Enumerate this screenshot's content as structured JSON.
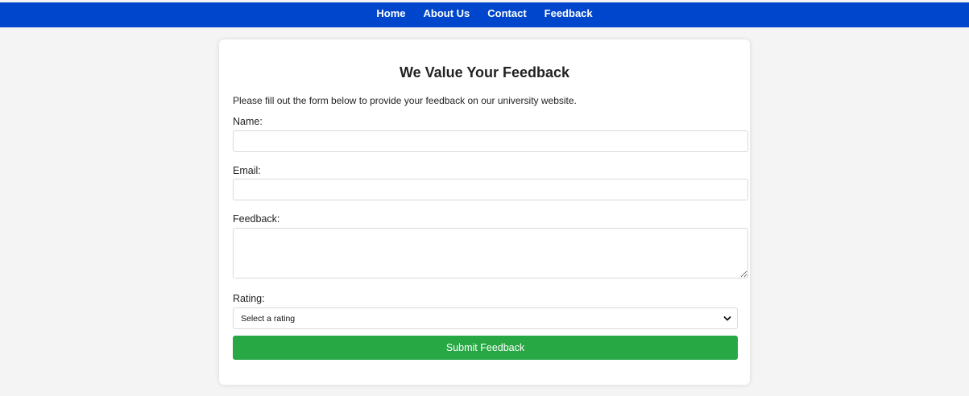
{
  "nav": {
    "items": [
      {
        "label": "Home"
      },
      {
        "label": "About Us"
      },
      {
        "label": "Contact"
      },
      {
        "label": "Feedback"
      }
    ]
  },
  "form": {
    "title": "We Value Your Feedback",
    "intro": "Please fill out the form below to provide your feedback on our university website.",
    "name_label": "Name:",
    "name_value": "",
    "email_label": "Email:",
    "email_value": "",
    "feedback_label": "Feedback:",
    "feedback_value": "",
    "rating_label": "Rating:",
    "rating_selected": "Select a rating",
    "submit_label": "Submit Feedback"
  },
  "colors": {
    "nav_background": "#0046cc",
    "submit_background": "#28a745",
    "page_background": "#f4f4f4"
  },
  "icons": {
    "select_arrow": "chevron-down-icon"
  }
}
